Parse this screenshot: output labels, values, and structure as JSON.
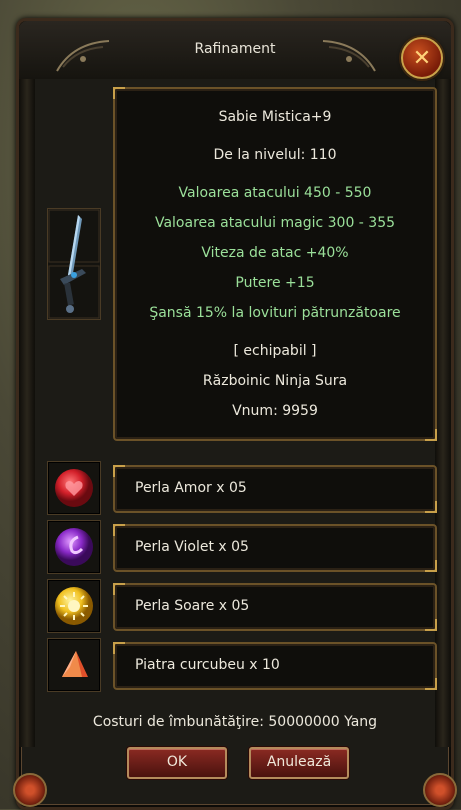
{
  "window": {
    "title": "Rafinament",
    "close_label": "✕"
  },
  "item": {
    "name": "Sabie Mistica+9",
    "level": "De la nivelul: 110",
    "attack": "Valoarea atacului 450 - 550",
    "magic_attack": "Valoarea atacului magic 300 - 355",
    "attack_speed": "Viteza de atac +40%",
    "strength": "Putere +15",
    "piercing": "Şansă 15% la lovituri pătrunzătoare",
    "equippable": "[ echipabil ]",
    "classes": "Războinic Ninja Sura",
    "vnum": "Vnum: 9959"
  },
  "materials": [
    {
      "label": "Perla Amor x 05",
      "icon": "red-pearl-icon",
      "color": "#d3202a"
    },
    {
      "label": "Perla Violet x 05",
      "icon": "violet-pearl-icon",
      "color": "#8a2ac8"
    },
    {
      "label": "Perla Soare x 05",
      "icon": "sun-pearl-icon",
      "color": "#f0c020"
    },
    {
      "label": "Piatra curcubeu x 10",
      "icon": "rainbow-stone-icon",
      "color": "#e0502a"
    }
  ],
  "cost": "Costuri de îmbunătăţire: 50000000 Yang",
  "buttons": {
    "ok": "OK",
    "cancel": "Anulează"
  },
  "colors": {
    "stat_green": "#9be09a",
    "text_white": "#ece8dc",
    "frame_gold": "#c8a04a"
  }
}
